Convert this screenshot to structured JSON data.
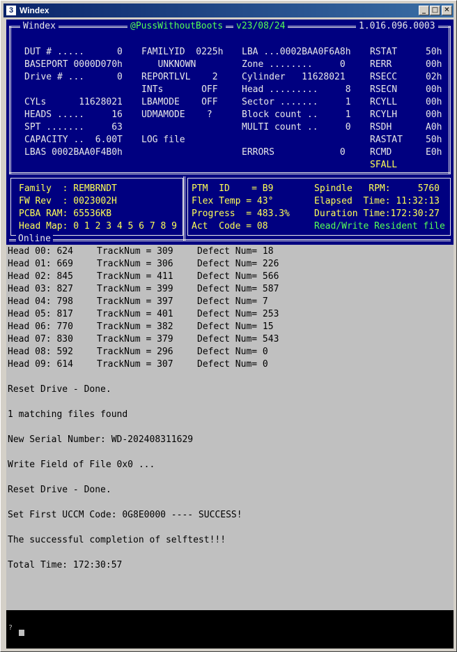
{
  "window": {
    "title": "Windex",
    "app_icon_text": "3",
    "minimize": "_",
    "maximize": "□",
    "close": "✕"
  },
  "header": {
    "app": "Windex",
    "user": "@PussWithoutBoots",
    "version": "v23/08/24",
    "build": "1.016.096.0003"
  },
  "drive_info": {
    "col1": [
      "DUT # .....      0",
      "BASEPORT 0000D070h",
      "Drive # ...      0",
      "",
      "CYLs      11628021",
      "HEADS .....     16",
      "SPT .......     63",
      "CAPACITY ..  6.00T",
      "LBAS 0002BAA0F4B0h"
    ],
    "col2": [
      "FAMILYID  0225h",
      "   UNKNOWN",
      "REPORTLVL    2",
      "INTs       OFF",
      "LBAMODE    OFF",
      "UDMAMODE    ?",
      "",
      "LOG file"
    ],
    "col3": [
      "LBA ...0002BAA0F6A8h",
      "Zone ........     0",
      "Cylinder   11628021",
      "Head .........     8",
      "Sector .......     1",
      "Block count ..     1",
      "MULTI count ..     0",
      "",
      "ERRORS            0"
    ],
    "col4_labels": [
      "RSTAT",
      "RERR",
      "RSECC",
      "RSECN",
      "RCYLL",
      "RCYLH",
      "RSDH",
      "RASTAT",
      "RCMD",
      "SFALL"
    ],
    "col4_values": [
      "50h",
      "00h",
      "02h",
      "00h",
      "00h",
      "00h",
      "A0h",
      "50h",
      "E0h",
      ""
    ]
  },
  "family_panel": {
    "lines": [
      "Family  : REMBRNDT",
      "FW Rev  : 0023002H",
      "PCBA RAM: 65536KB",
      "Head Map: 0 1 2 3 4 5 6 7 8 9"
    ]
  },
  "status_panel": {
    "left": [
      "PTM  ID    = B9",
      "Flex Temp = 43°",
      "Progress  = 483.3%",
      "Act  Code = 08"
    ],
    "right": [
      "Spindle   RPM:     5760",
      "Elapsed  Time: 11:32:13",
      "Duration Time:172:30:27"
    ],
    "mode": "Read/Write Resident file",
    "online_label": "Online"
  },
  "heads": [
    {
      "head": "Head 00: 624",
      "track": "TrackNum = 309",
      "defect": "Defect Num= 18"
    },
    {
      "head": "Head 01: 669",
      "track": "TrackNum = 306",
      "defect": "Defect Num= 226"
    },
    {
      "head": "Head 02: 845",
      "track": "TrackNum = 411",
      "defect": "Defect Num= 566"
    },
    {
      "head": "Head 03: 827",
      "track": "TrackNum = 399",
      "defect": "Defect Num= 587"
    },
    {
      "head": "Head 04: 798",
      "track": "TrackNum = 397",
      "defect": "Defect Num= 7"
    },
    {
      "head": "Head 05: 817",
      "track": "TrackNum = 401",
      "defect": "Defect Num= 253"
    },
    {
      "head": "Head 06: 770",
      "track": "TrackNum = 382",
      "defect": "Defect Num= 15"
    },
    {
      "head": "Head 07: 830",
      "track": "TrackNum = 379",
      "defect": "Defect Num= 543"
    },
    {
      "head": "Head 08: 592",
      "track": "TrackNum = 296",
      "defect": "Defect Num= 0"
    },
    {
      "head": "Head 09: 614",
      "track": "TrackNum = 307",
      "defect": "Defect Num= 0"
    }
  ],
  "log": [
    "Reset Drive - Done.",
    "1 matching files found",
    "New Serial Number: WD-202408311629",
    "Write Field of File 0x0 ...",
    "Reset Drive - Done.",
    "Set First UCCM Code: 0G8E0000 ---- SUCCESS!",
    "The successful completion of selftest!!!",
    "Total Time: 172:30:57"
  ],
  "prompt": {
    "glyph": "?"
  },
  "colors": {
    "panel": "#000080",
    "label": "#ffff55",
    "mode": "#55ff55",
    "console": "#c0c0c0"
  }
}
